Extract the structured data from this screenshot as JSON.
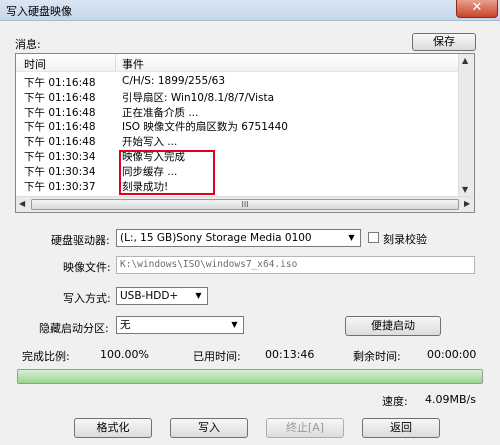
{
  "window": {
    "title": "写入硬盘映像",
    "close": "✕"
  },
  "log": {
    "label": "消息:",
    "save": "保存",
    "columns": [
      "时间",
      "事件"
    ],
    "rows": [
      [
        "下午 01:16:48",
        "C/H/S: 1899/255/63"
      ],
      [
        "下午 01:16:48",
        "引导扇区: Win10/8.1/8/7/Vista"
      ],
      [
        "下午 01:16:48",
        "正在准备介质 ..."
      ],
      [
        "下午 01:16:48",
        "ISO 映像文件的扇区数为 6751440"
      ],
      [
        "下午 01:16:48",
        "开始写入 ..."
      ],
      [
        "下午 01:30:34",
        "映像写入完成"
      ],
      [
        "下午 01:30:34",
        "同步缓存 ..."
      ],
      [
        "下午 01:30:37",
        "刻录成功!"
      ]
    ]
  },
  "form": {
    "drive_label": "硬盘驱动器:",
    "drive_value": "(L:, 15 GB)Sony     Storage Media    0100",
    "verify_label": "刻录校验",
    "image_label": "映像文件:",
    "image_value": "K:\\windows\\ISO\\windows7_x64.iso",
    "method_label": "写入方式:",
    "method_value": "USB-HDD+",
    "hidden_label": "隐藏启动分区:",
    "hidden_value": "无",
    "quick_boot": "便捷启动"
  },
  "status": {
    "ratio_label": "完成比例:",
    "ratio_value": "100.00%",
    "elapsed_label": "已用时间:",
    "elapsed_value": "00:13:46",
    "remaining_label": "剩余时间:",
    "remaining_value": "00:00:00",
    "progress": 1.0,
    "speed_label": "速度:",
    "speed_value": "4.09MB/s"
  },
  "buttons": {
    "format": "格式化",
    "write": "写入",
    "stop": "终止[A]",
    "back": "返回"
  },
  "icons": {
    "scroll_up": "▲",
    "scroll_down": "▼",
    "scroll_left": "◀",
    "scroll_right": "▶",
    "thumb_grip": "III",
    "dropdown": "▼"
  }
}
